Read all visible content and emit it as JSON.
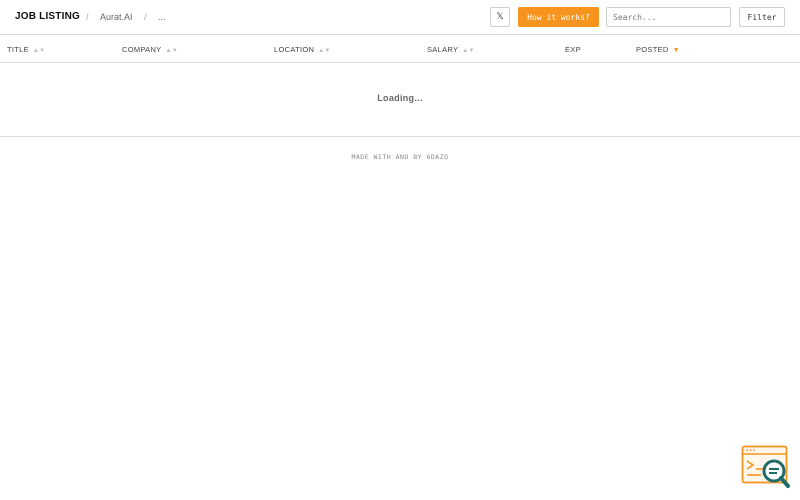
{
  "header": {
    "brand": "JOB LISTING",
    "breadcrumb": [
      "Aurat.AI",
      "..."
    ],
    "x_button": "𝕏",
    "how_button": "How it works?",
    "search_placeholder": "Search...",
    "filter_button": "Filter"
  },
  "table": {
    "columns": [
      {
        "label": "TITLE",
        "sort": "▲▼"
      },
      {
        "label": "COMPANY",
        "sort": "▲▼"
      },
      {
        "label": "LOCATION",
        "sort": "▲▼"
      },
      {
        "label": "SALARY",
        "sort": "▲▼"
      },
      {
        "label": "EXP",
        "sort": ""
      },
      {
        "label": "POSTED",
        "sort": "▼"
      }
    ],
    "loading_text": "Loading..."
  },
  "footer": {
    "text": "MADE WITH  AND  BY 6DAZO"
  },
  "icons": {
    "widget": "browser-search-icon",
    "accent_color": "#f7941d"
  }
}
